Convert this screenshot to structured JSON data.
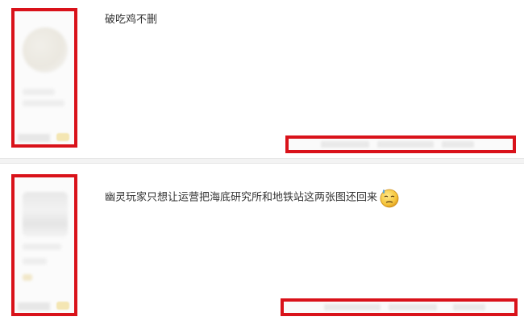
{
  "posts": [
    {
      "text": "破吃鸡不删"
    },
    {
      "text": "幽灵玩家只想让运营把海底研究所和地铁站这两张图还回来",
      "emoji": "sweat-smile-emoji"
    }
  ],
  "colors": {
    "highlight_box": "#d9121a",
    "text": "#333333",
    "divider": "#f3f3f3"
  }
}
